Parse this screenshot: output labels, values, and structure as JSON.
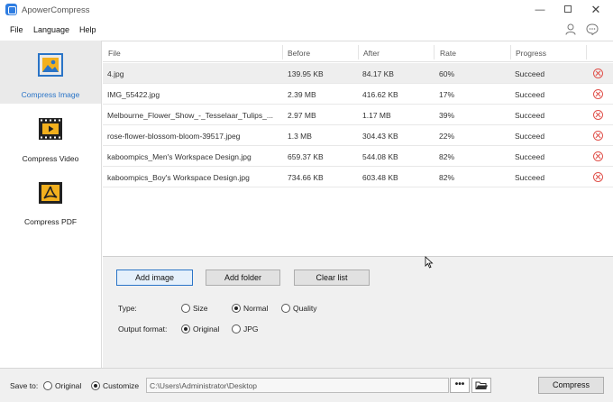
{
  "window": {
    "title": "ApowerCompress",
    "minimize": "—",
    "close": "✕"
  },
  "menu": {
    "file": "File",
    "language": "Language",
    "help": "Help"
  },
  "sidebar": {
    "items": [
      {
        "label": "Compress Image",
        "icon": "image-icon",
        "active": true
      },
      {
        "label": "Compress Video",
        "icon": "video-icon",
        "active": false
      },
      {
        "label": "Compress PDF",
        "icon": "pdf-icon",
        "active": false
      }
    ]
  },
  "table": {
    "headers": {
      "file": "File",
      "before": "Before",
      "after": "After",
      "rate": "Rate",
      "progress": "Progress"
    },
    "rows": [
      {
        "file": "4.jpg",
        "before": "139.95 KB",
        "after": "84.17 KB",
        "rate": "60%",
        "progress": "Succeed"
      },
      {
        "file": "IMG_55422.jpg",
        "before": "2.39 MB",
        "after": "416.62 KB",
        "rate": "17%",
        "progress": "Succeed"
      },
      {
        "file": "Melbourne_Flower_Show_-_Tesselaar_Tulips_...",
        "before": "2.97 MB",
        "after": "1.17 MB",
        "rate": "39%",
        "progress": "Succeed"
      },
      {
        "file": "rose-flower-blossom-bloom-39517.jpeg",
        "before": "1.3 MB",
        "after": "304.43 KB",
        "rate": "22%",
        "progress": "Succeed"
      },
      {
        "file": "kaboompics_Men's Workspace Design.jpg",
        "before": "659.37 KB",
        "after": "544.08 KB",
        "rate": "82%",
        "progress": "Succeed"
      },
      {
        "file": "kaboompics_Boy's Workspace Design.jpg",
        "before": "734.66 KB",
        "after": "603.48 KB",
        "rate": "82%",
        "progress": "Succeed"
      }
    ]
  },
  "panel": {
    "add_image": "Add image",
    "add_folder": "Add folder",
    "clear_list": "Clear list",
    "type_label": "Type:",
    "type_options": [
      "Size",
      "Normal",
      "Quality"
    ],
    "type_selected": "Normal",
    "format_label": "Output format:",
    "format_options": [
      "Original",
      "JPG"
    ],
    "format_selected": "Original"
  },
  "footer": {
    "save_to_label": "Save to:",
    "save_options": [
      "Original",
      "Customize"
    ],
    "save_selected": "Customize",
    "path_value": "C:\\Users\\Administrator\\Desktop",
    "browse_label": "•••",
    "compress_label": "Compress"
  },
  "colors": {
    "accent": "#2a74c7",
    "delete": "#e0514b",
    "icon_yellow": "#f2b01e"
  }
}
